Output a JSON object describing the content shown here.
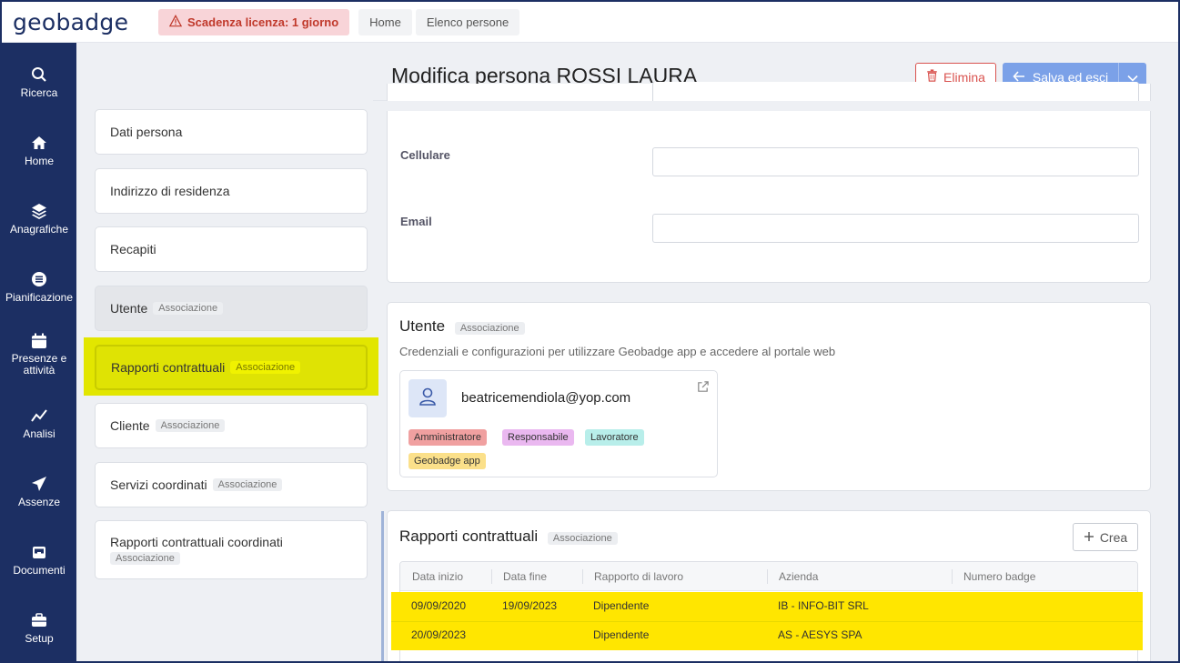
{
  "topbar": {
    "logo": "geobadge",
    "license_label": "Scadenza licenza: 1 giorno",
    "breadcrumbs": [
      "Home",
      "Elenco persone"
    ]
  },
  "nav": {
    "items": [
      {
        "label": "Ricerca",
        "icon": "search-icon"
      },
      {
        "label": "Home",
        "icon": "home-icon"
      },
      {
        "label": "Anagrafiche",
        "icon": "layers-icon"
      },
      {
        "label": "Pianificazione",
        "icon": "list-circle-icon"
      },
      {
        "label": "Presenze e attività",
        "icon": "calendar-icon"
      },
      {
        "label": "Analisi",
        "icon": "chart-line-icon"
      },
      {
        "label": "Assenze",
        "icon": "paper-plane-icon"
      },
      {
        "label": "Documenti",
        "icon": "inbox-icon"
      },
      {
        "label": "Setup",
        "icon": "briefcase-icon"
      }
    ]
  },
  "sections": [
    {
      "label": "Dati persona",
      "tag": ""
    },
    {
      "label": "Indirizzo di residenza",
      "tag": ""
    },
    {
      "label": "Recapiti",
      "tag": ""
    },
    {
      "label": "Utente",
      "tag": "Associazione"
    },
    {
      "label": "Rapporti contrattuali",
      "tag": "Associazione"
    },
    {
      "label": "Cliente",
      "tag": "Associazione"
    },
    {
      "label": "Servizi coordinati",
      "tag": "Associazione"
    },
    {
      "label": "Rapporti contrattuali coordinati",
      "tag": "Associazione"
    }
  ],
  "header": {
    "title": "Modifica persona ROSSI LAURA",
    "delete_label": "Elimina",
    "save_label": "Salva ed esci"
  },
  "contacts": {
    "phone_label": "Cellulare",
    "phone_value": "",
    "email_label": "Email",
    "email_value": ""
  },
  "user_card": {
    "title": "Utente",
    "tag": "Associazione",
    "subtitle": "Credenziali e configurazioni per utilizzare Geobadge app e accedere al portale web",
    "email": "beatricemendiola@yop.com",
    "roles": [
      {
        "label": "Amministratore",
        "color": "#f0a0a0"
      },
      {
        "label": "Responsabile",
        "color": "#eab8f0"
      },
      {
        "label": "Lavoratore",
        "color": "#b8eeea"
      },
      {
        "label": "Geobadge app",
        "color": "#fbe08a"
      }
    ]
  },
  "contracts_card": {
    "title": "Rapporti contrattuali",
    "tag": "Associazione",
    "create_label": "Crea",
    "columns": [
      "Data inizio",
      "Data fine",
      "Rapporto di lavoro",
      "Azienda",
      "Numero badge"
    ],
    "rows": [
      [
        "09/09/2020",
        "19/09/2023",
        "Dipendente",
        "IB - INFO-BIT SRL",
        ""
      ],
      [
        "20/09/2023",
        "",
        "Dipendente",
        "AS - AESYS SPA",
        ""
      ]
    ]
  },
  "colors": {
    "nav_bg": "#1c2f63",
    "highlight": "#ffe600",
    "primary": "#7ba1e8",
    "danger": "#d9534f"
  }
}
